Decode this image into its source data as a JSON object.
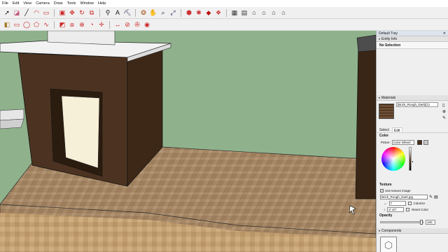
{
  "menu": [
    "File",
    "Edit",
    "View",
    "Camera",
    "Draw",
    "Tools",
    "Window",
    "Help"
  ],
  "toolbar1_icons": [
    "select-icon",
    "eraser-icon",
    "line-icon",
    "arc-icon",
    "shape-icon",
    "push-pull-icon",
    "move-icon",
    "rotate-icon",
    "offset-icon",
    "tape-icon",
    "text-icon",
    "paint-bucket-icon",
    "orbit-icon",
    "pan-icon",
    "zoom-icon",
    "zoom-extents-icon",
    "warehouse-icon",
    "extension-icon",
    "ruby-icon",
    "layout-icon",
    "components-icon",
    "materials-icon",
    "styles-icon",
    "scenes-icon"
  ],
  "toolbar2_icons": [
    "make-component-icon",
    "rectangle-icon",
    "circle-icon",
    "polygon-icon",
    "freehand-icon",
    "follow-me-icon",
    "scale-icon",
    "intersect-icon",
    "protractor-icon",
    "axes-icon",
    "dimension-icon",
    "section-icon",
    "walk-icon",
    "look-around-icon",
    "position-camera-icon",
    "previous-view-icon"
  ],
  "tray": {
    "title": "Default Tray",
    "entity_info_label": "Entity Info",
    "selection_text": "No Selection",
    "materials_label": "Materials",
    "material_name": "[Brick_Rough_Dark](1)",
    "tab_select": "Select",
    "tab_edit": "Edit",
    "color_label": "Color",
    "picker_label": "Picker:",
    "picker_value": "Color Wheel",
    "texture_label": "Texture",
    "use_texture_label": "Use texture image",
    "texture_file": "Brick_Rough_Dark.jpg",
    "width_value": "7",
    "height_value": "3' 10\"",
    "colorize_label": "Colorize",
    "reset_color_label": "Reset Color",
    "opacity_label": "Opacity",
    "opacity_value": "100",
    "opacity_fraction": 1.0,
    "components_label": "Components"
  },
  "colors": {
    "sky": "#8fb28c",
    "wall_dark": "#4c3321",
    "floor": "#a88966",
    "roof_white": "#f2f2f2",
    "opening_cream": "#f6f0d8"
  }
}
